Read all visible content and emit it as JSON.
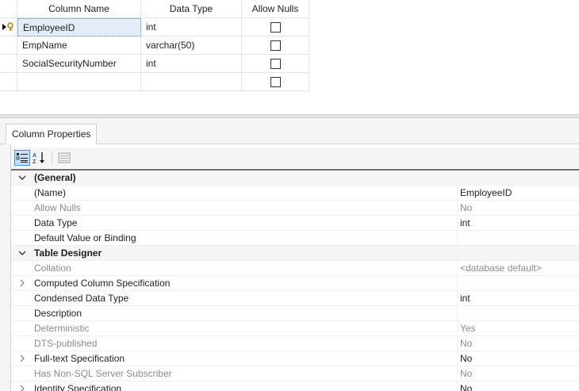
{
  "grid": {
    "headers": [
      "Column Name",
      "Data Type",
      "Allow Nulls"
    ],
    "rows": [
      {
        "name": "EmployeeID",
        "type": "int"
      },
      {
        "name": "EmpName",
        "type": "varchar(50)"
      },
      {
        "name": "SocialSecurityNumber",
        "type": "int"
      },
      {
        "name": "",
        "type": ""
      }
    ]
  },
  "panel": {
    "tab_label": "Column Properties"
  },
  "properties": {
    "cat_general": "(General)",
    "name_label": "(Name)",
    "name_value": "EmployeeID",
    "allow_nulls_label": "Allow Nulls",
    "allow_nulls_value": "No",
    "data_type_label": "Data Type",
    "data_type_value": "int",
    "default_label": "Default Value or Binding",
    "default_value": "",
    "cat_table_designer": "Table Designer",
    "collation_label": "Collation",
    "collation_value": "<database default>",
    "computed_label": "Computed Column Specification",
    "computed_value": "",
    "condensed_label": "Condensed Data Type",
    "condensed_value": "int",
    "description_label": "Description",
    "description_value": "",
    "deterministic_label": "Deterministic",
    "deterministic_value": "Yes",
    "dts_label": "DTS-published",
    "dts_value": "No",
    "fulltext_label": "Full-text Specification",
    "fulltext_value": "No",
    "nosql_label": "Has Non-SQL Server Subscriber",
    "nosql_value": "No",
    "identity_label": "Identity Specification",
    "identity_value": "No"
  },
  "icons": {
    "categorized": "categorized-icon",
    "alphabetical": "sort-alphabetical-icon",
    "property_pages": "property-pages-icon",
    "key": "primary-key-icon",
    "row_pointer": "row-pointer-icon"
  }
}
